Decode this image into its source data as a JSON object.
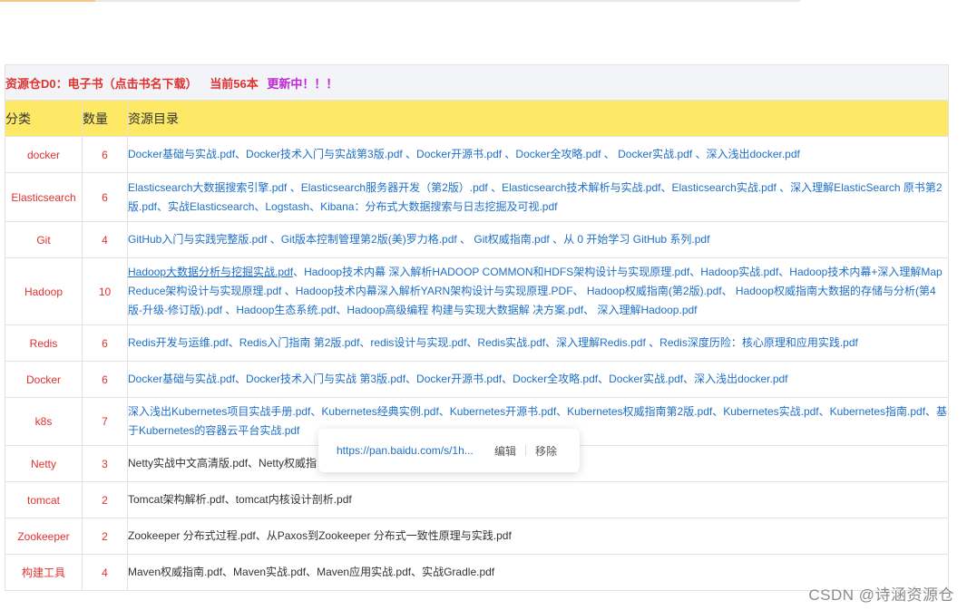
{
  "table": {
    "title": "资源仓D0：电子书（点击书名下载）",
    "count_text": "当前56本",
    "update_text": "更新中！！！",
    "headers": [
      "分类",
      "数量",
      "资源目录"
    ],
    "rows": [
      {
        "category": "docker",
        "count": "6",
        "items": "Docker基础与实战.pdf、Docker技术入门与实战第3版.pdf 、Docker开源书.pdf 、Docker全攻略.pdf 、 Docker实战.pdf 、深入浅出docker.pdf"
      },
      {
        "category": "Elasticsearch",
        "count": "6",
        "items": " Elasticsearch大数据搜索引擎.pdf 、Elasticsearch服务器开发（第2版）.pdf 、Elasticsearch技术解析与实战.pdf、Elasticsearch实战.pdf 、深入理解ElasticSearch 原书第2版.pdf、实战Elasticsearch、Logstash、Kibana：分布式大数据搜索与日志挖掘及可视.pdf"
      },
      {
        "category": "Git",
        "count": "4",
        "items": " GitHub入门与实践完整版.pdf 、Git版本控制管理第2版(美)罗力格.pdf 、 Git权威指南.pdf 、从 0 开始学习 GitHub 系列.pdf"
      },
      {
        "category": "Hadoop",
        "count": "10",
        "first": " Hadoop大数据分析与挖掘实战.pdf",
        "items": "、Hadoop技术内幕 深入解析HADOOP COMMON和HDFS架构设计与实现原理.pdf、Hadoop实战.pdf、Hadoop技术内幕+深入理解MapReduce架构设计与实现原理.pdf 、Hadoop技术内幕深入解析YARN架构设计与实现原理.PDF、 Hadoop权威指南(第2版).pdf、 Hadoop权威指南大数据的存储与分析(第4版-升级-修订版).pdf 、Hadoop生态系统.pdf、Hadoop高级编程 构建与实现大数据解 决方案.pdf、 深入理解Hadoop.pdf"
      },
      {
        "category": "Redis",
        "count": "6",
        "items": "Redis开发与运维.pdf、Redis入门指南 第2版.pdf、redis设计与实现.pdf、Redis实战.pdf、深入理解Redis.pdf 、Redis深度历险：核心原理和应用实践.pdf"
      },
      {
        "category": "Docker",
        "count": "6",
        "items": "Docker基础与实战.pdf、Docker技术入门与实战 第3版.pdf、Docker开源书.pdf、Docker全攻略.pdf、Docker实战.pdf、深入浅出docker.pdf"
      },
      {
        "category": "k8s",
        "count": "7",
        "items": "深入浅出Kubernetes项目实战手册.pdf、Kubernetes经典实例.pdf、Kubernetes开源书.pdf、Kubernetes权威指南第2版.pdf、Kubernetes实战.pdf、Kubernetes指南.pdf、基于Kubernetes的容器云平台实战.pdf"
      },
      {
        "category": "Netty",
        "count": "3",
        "items": "Netty实战中文高清版.pdf、Netty权威指"
      },
      {
        "category": "tomcat",
        "count": "2",
        "items": "Tomcat架构解析.pdf、tomcat内核设计剖析.pdf"
      },
      {
        "category": "Zookeeper",
        "count": "2",
        "items": "Zookeeper 分布式过程.pdf、从Paxos到Zookeeper 分布式一致性原理与实践.pdf"
      },
      {
        "category": "构建工具",
        "count": "4",
        "items": "Maven权威指南.pdf、Maven实战.pdf、Maven应用实战.pdf、实战Gradle.pdf"
      }
    ]
  },
  "popover": {
    "url": "https://pan.baidu.com/s/1h...",
    "edit_label": "编辑",
    "remove_label": "移除"
  },
  "watermark": "CSDN @诗涵资源仓",
  "colors": {
    "category": "#e03131",
    "link": "#1e6fc8",
    "header_bg": "#fde966",
    "update": "#c026d3"
  }
}
